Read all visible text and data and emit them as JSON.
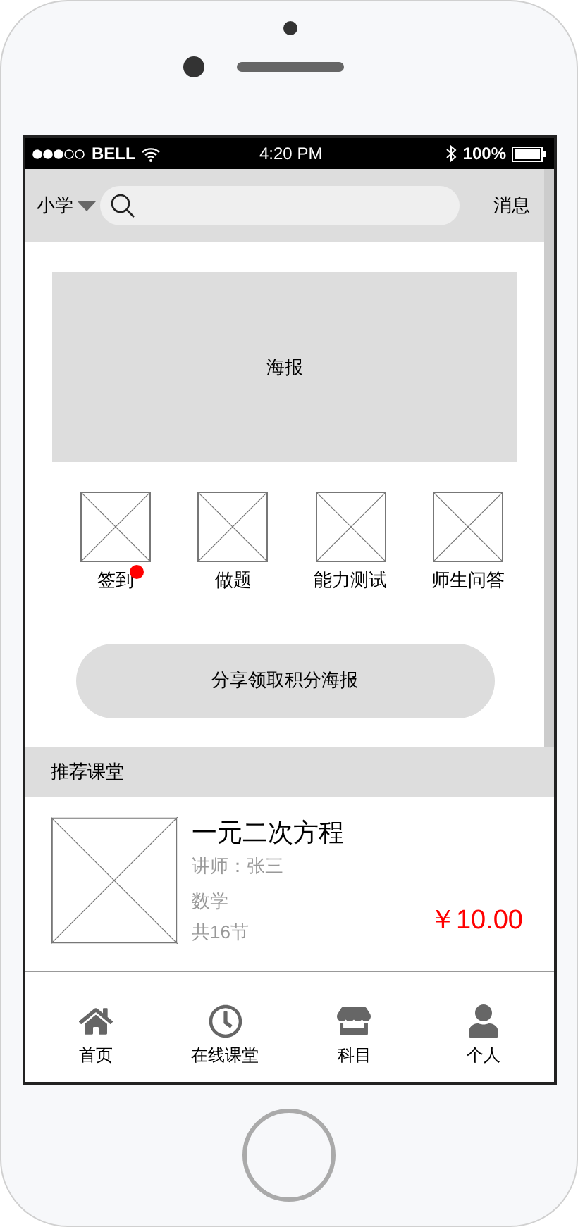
{
  "status_bar": {
    "carrier": "BELL",
    "time": "4:20 PM",
    "battery": "100%"
  },
  "header": {
    "grade": "小学",
    "messages": "消息"
  },
  "banner": {
    "label": "海报"
  },
  "shortcuts": [
    {
      "label": "签到",
      "badge": true
    },
    {
      "label": "做题",
      "badge": false
    },
    {
      "label": "能力测试",
      "badge": false
    },
    {
      "label": "师生问答",
      "badge": false
    }
  ],
  "share_button": "分享领取积分海报",
  "section_title": "推荐课堂",
  "courses": [
    {
      "title": "一元二次方程",
      "teacher": "讲师：张三",
      "subject": "数学",
      "lessons": "共16节",
      "price": "￥10.00"
    }
  ],
  "bottom_nav": [
    {
      "label": "首页",
      "kind": "home"
    },
    {
      "label": "在线课堂",
      "kind": "clock"
    },
    {
      "label": "科目",
      "kind": "store"
    },
    {
      "label": "个人",
      "kind": "user"
    }
  ]
}
